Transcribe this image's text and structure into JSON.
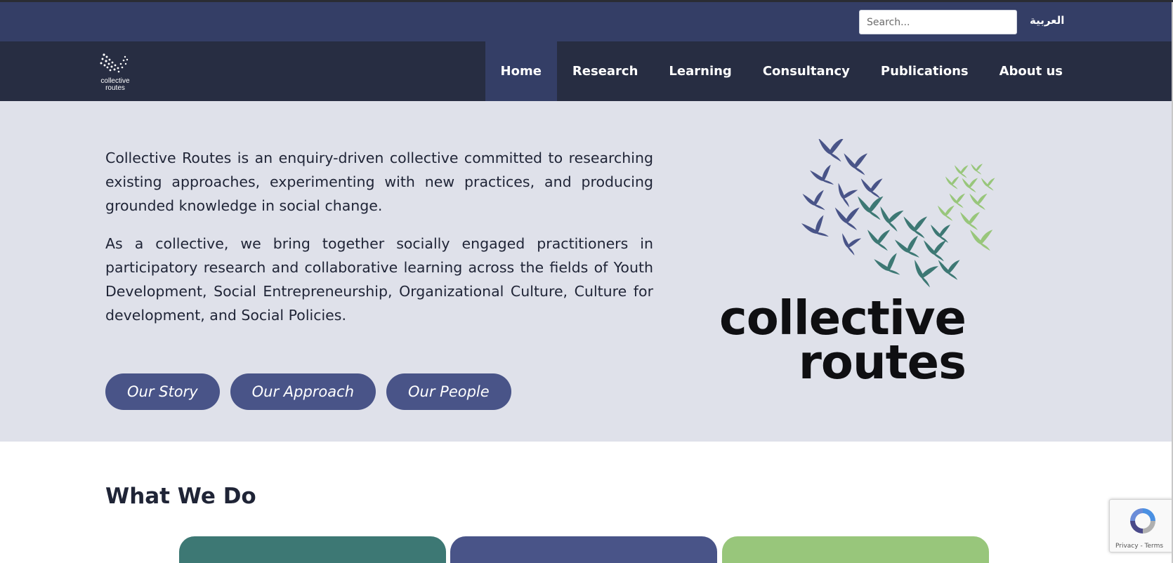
{
  "topbar": {
    "search_placeholder": "Search...",
    "language_link": "العربية"
  },
  "logo": {
    "alt_text": "collective routes",
    "word1": "collective",
    "word2": "routes"
  },
  "nav": {
    "items": [
      {
        "label": "Home",
        "active": true
      },
      {
        "label": "Research",
        "active": false
      },
      {
        "label": "Learning",
        "active": false
      },
      {
        "label": "Consultancy",
        "active": false
      },
      {
        "label": "Publications",
        "active": false
      },
      {
        "label": "About us",
        "active": false
      }
    ]
  },
  "hero": {
    "paragraph1": "Collective Routes is an enquiry-driven collective committed to researching existing approaches, experimenting with new practices, and producing grounded knowledge in social change.",
    "paragraph2": "As a collective, we bring together socially engaged practitioners in participatory research and collaborative learning across the fields of Youth Development, Social Entrepreneurship, Organizational Culture, Culture for development, and Social Policies.",
    "buttons": [
      "Our Story",
      "Our Approach",
      "Our People"
    ]
  },
  "what_we_do": {
    "title": "What We Do"
  },
  "recaptcha": {
    "links": "Privacy - Terms"
  },
  "colors": {
    "topbar": "#343e66",
    "navbar": "#272d42",
    "hero_bg": "#dfe1ea",
    "button": "#495488",
    "card_teal": "#3d7874",
    "card_navy": "#495488",
    "card_green": "#98c67b"
  }
}
